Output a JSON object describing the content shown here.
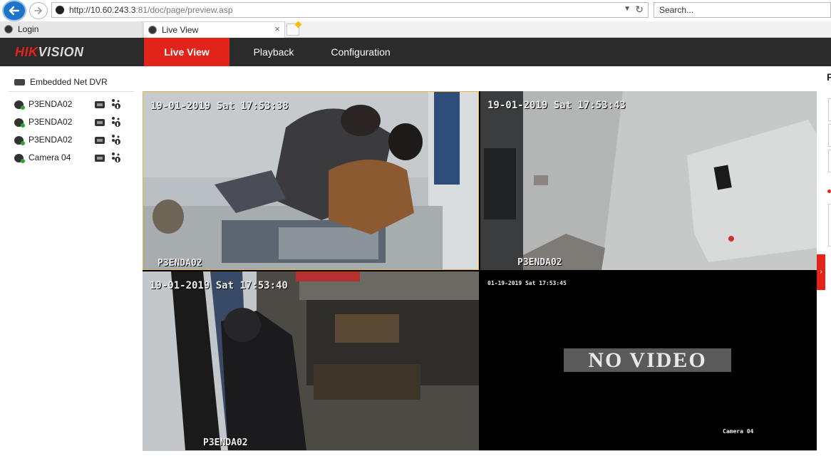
{
  "browser": {
    "url_base": "http://10.60.243.3",
    "url_rest": ":81/doc/page/preview.asp",
    "search_placeholder": "Search...",
    "tabs": [
      {
        "label": "Login"
      },
      {
        "label": "Live View"
      }
    ],
    "close_glyph": "×"
  },
  "app": {
    "brand_red": "HIK",
    "brand_rest": "VISION",
    "nav": [
      {
        "label": "Live View"
      },
      {
        "label": "Playback"
      },
      {
        "label": "Configuration"
      }
    ],
    "active_color": "#e2231a"
  },
  "sidebar": {
    "device": "Embedded Net DVR",
    "cameras": [
      {
        "name": "P3ENDA02"
      },
      {
        "name": "P3ENDA02"
      },
      {
        "name": "P3ENDA02"
      },
      {
        "name": "Camera 04"
      }
    ]
  },
  "video": {
    "panes": [
      {
        "timestamp": "19-01-2019 Sat 17:53:38",
        "label": "P3ENDA02"
      },
      {
        "timestamp": "19-01-2019 Sat 17:53:43",
        "label": "P3ENDA02"
      },
      {
        "timestamp": "19-01-2019 Sat 17:53:40",
        "label": "P3ENDA02"
      },
      {
        "timestamp": "01-19-2019 Sat 17:53:45",
        "label": "Camera 04",
        "no_video": "NO VIDEO"
      }
    ]
  },
  "right_panel": {
    "letter": "F",
    "toggle_glyph": "›"
  }
}
